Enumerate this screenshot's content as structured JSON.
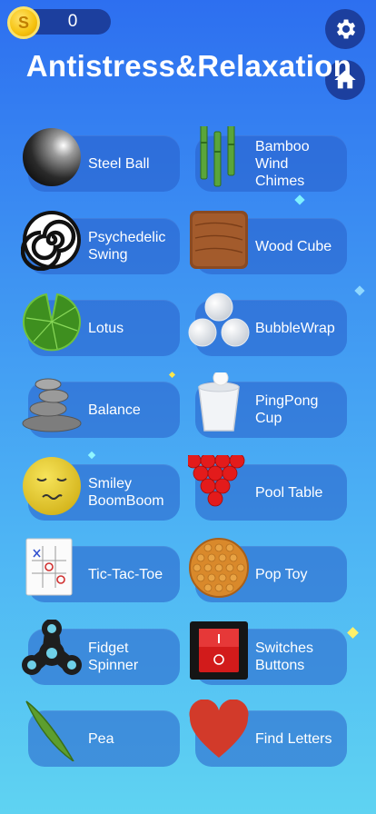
{
  "coins": {
    "value": "0",
    "symbol": "S"
  },
  "title": "Antistress&Relaxation",
  "buttons": {
    "settings_icon": "gear-icon",
    "home_icon": "home-icon"
  },
  "games": [
    {
      "label": "Steel Ball",
      "icon": "steel-ball-icon"
    },
    {
      "label": "Bamboo\nWind Chimes",
      "icon": "bamboo-icon"
    },
    {
      "label": "Psychedelic\nSwing",
      "icon": "spiral-icon"
    },
    {
      "label": "Wood Cube",
      "icon": "wood-cube-icon"
    },
    {
      "label": "Lotus",
      "icon": "lotus-leaf-icon"
    },
    {
      "label": "BubbleWrap",
      "icon": "bubbles-icon"
    },
    {
      "label": "Balance",
      "icon": "stacked-stones-icon"
    },
    {
      "label": "PingPong\nCup",
      "icon": "pingpong-cup-icon"
    },
    {
      "label": "Smiley\nBoomBoom",
      "icon": "smiley-icon"
    },
    {
      "label": "Pool Table",
      "icon": "pool-balls-icon"
    },
    {
      "label": "Tic-Tac-Toe",
      "icon": "tic-tac-toe-icon"
    },
    {
      "label": "Pop Toy",
      "icon": "pop-toy-icon"
    },
    {
      "label": "Fidget\nSpinner",
      "icon": "fidget-spinner-icon"
    },
    {
      "label": "Switches\nButtons",
      "icon": "red-switch-icon"
    },
    {
      "label": "Pea",
      "icon": "pea-pod-icon"
    },
    {
      "label": "Find Letters",
      "icon": "heart-icon"
    }
  ]
}
